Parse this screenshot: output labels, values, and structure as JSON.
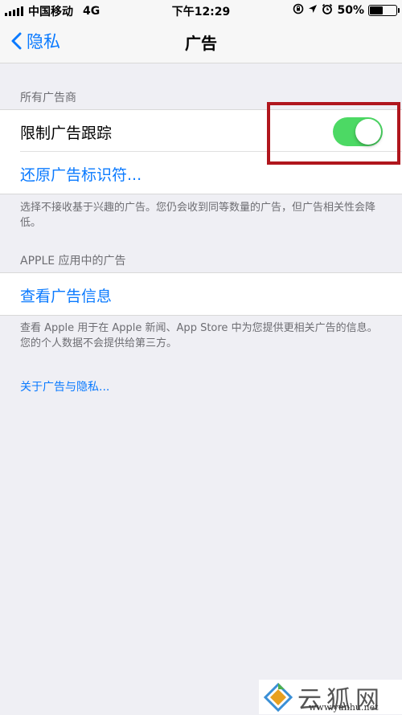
{
  "status_bar": {
    "carrier": "中国移动",
    "network": "4G",
    "time": "下午12:29",
    "battery_percent": "50%",
    "battery_level": 0.5
  },
  "nav": {
    "back_label": "隐私",
    "title": "广告"
  },
  "section1": {
    "header": "所有广告商",
    "limit_tracking_label": "限制广告跟踪",
    "limit_tracking_on": true,
    "reset_label": "还原广告标识符...",
    "footer": "选择不接收基于兴趣的广告。您仍会收到同等数量的广告，但广告相关性会降低。"
  },
  "section2": {
    "header": "APPLE 应用中的广告",
    "view_info_label": "查看广告信息",
    "footer": "查看 Apple 用于在 Apple 新闻、App Store 中为您提供更相关广告的信息。您的个人数据不会提供给第三方。"
  },
  "about_link": "关于广告与隐私...",
  "watermark": {
    "text": "云狐网",
    "url": "www.yunhu.net"
  },
  "colors": {
    "accent": "#0a7aff",
    "toggle_on": "#4cd964",
    "highlight_box": "#b0161d",
    "background": "#efeff4"
  }
}
